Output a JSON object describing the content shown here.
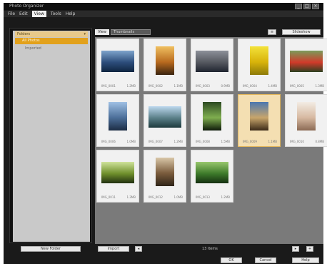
{
  "window": {
    "title": "Photo Organizer"
  },
  "title_controls": [
    "_",
    "□",
    "×"
  ],
  "menu": [
    {
      "label": "File"
    },
    {
      "label": "Edit"
    },
    {
      "label": "View"
    },
    {
      "label": "Tools"
    },
    {
      "label": "Help"
    }
  ],
  "sidebar": {
    "header": {
      "label": "Folders",
      "arrow": "▾"
    },
    "selected": "All Photos",
    "child": "Imported",
    "footer_button": "New Folder"
  },
  "topbar": {
    "view_label": "View",
    "view_select": "Thumbnails",
    "icon_button": "≡",
    "text_button": "Slideshow"
  },
  "thumbnails": [
    {
      "name": "IMG_0001",
      "size": "1.2MB",
      "selected": false,
      "colors": [
        "#7fa4cc",
        "#2c4d7b",
        "#0f2440"
      ]
    },
    {
      "name": "IMG_0002",
      "size": "1.1MB",
      "selected": false,
      "colors": [
        "#f0c060",
        "#b86a1e",
        "#3a2410"
      ]
    },
    {
      "name": "IMG_0003",
      "size": "0.9MB",
      "selected": false,
      "colors": [
        "#8c9099",
        "#55585f",
        "#1f2430"
      ]
    },
    {
      "name": "IMG_0004",
      "size": "1.4MB",
      "selected": false,
      "colors": [
        "#f3e23a",
        "#d8b30a",
        "#8d7a09"
      ]
    },
    {
      "name": "IMG_0005",
      "size": "1.3MB",
      "selected": false,
      "colors": [
        "#7a9c5a",
        "#d13a2a",
        "#2c4020"
      ]
    },
    {
      "name": "IMG_0006",
      "size": "1.0MB",
      "selected": false,
      "colors": [
        "#9fc0e4",
        "#4c6f99",
        "#1c2c44"
      ]
    },
    {
      "name": "IMG_0007",
      "size": "1.2MB",
      "selected": false,
      "colors": [
        "#bcd8ee",
        "#5a7f88",
        "#1d3a3d"
      ]
    },
    {
      "name": "IMG_0008",
      "size": "1.5MB",
      "selected": false,
      "colors": [
        "#2d4a22",
        "#7fae4f",
        "#0e1a0a"
      ]
    },
    {
      "name": "IMG_0009",
      "size": "1.1MB",
      "selected": true,
      "colors": [
        "#4b78b0",
        "#c8a56b",
        "#3b2a18"
      ]
    },
    {
      "name": "IMG_0010",
      "size": "0.8MB",
      "selected": false,
      "colors": [
        "#f3ece4",
        "#d7b9a1",
        "#8b6a54"
      ]
    },
    {
      "name": "IMG_0011",
      "size": "1.3MB",
      "selected": false,
      "colors": [
        "#cfe39a",
        "#6f8f2b",
        "#223111"
      ]
    },
    {
      "name": "IMG_0012",
      "size": "1.0MB",
      "selected": false,
      "colors": [
        "#d9c7a8",
        "#7a5b3c",
        "#2f2418"
      ]
    },
    {
      "name": "IMG_0013",
      "size": "1.2MB",
      "selected": false,
      "colors": [
        "#98c76d",
        "#3d7a2a",
        "#153011"
      ]
    }
  ],
  "bottombar": {
    "import_button": "Import",
    "prev_button": "◂",
    "status": "13 items",
    "next_button": "▸",
    "zoom_button": "+"
  },
  "footer": {
    "ok_button": "OK",
    "cancel_button": "Cancel",
    "help_button": "Help"
  },
  "colors": {
    "accent": "#e2a11c",
    "selection": "#f4dfb2",
    "grid_bg": "#7a7a7a",
    "window_bg": "#1a1a1a"
  }
}
